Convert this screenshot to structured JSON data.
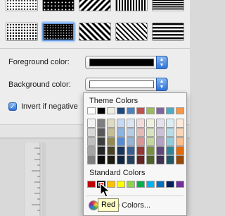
{
  "patterns": [
    {
      "name": "pattern-dots-small",
      "kind": "dots-small",
      "selected": false
    },
    {
      "name": "pattern-dots-medium",
      "kind": "dots-medium",
      "selected": false
    },
    {
      "name": "pattern-diagonal-wide",
      "kind": "diag-wide",
      "selected": false
    },
    {
      "name": "pattern-vertical-lines",
      "kind": "vertical",
      "selected": false
    },
    {
      "name": "pattern-horizontal-lines",
      "kind": "horizontal-fine",
      "selected": false
    },
    {
      "name": "pattern-dots-large",
      "kind": "dots-large",
      "selected": false
    },
    {
      "name": "pattern-dots-dense",
      "kind": "dots-dense",
      "selected": true
    },
    {
      "name": "pattern-diagonal-thick",
      "kind": "diag-thick",
      "selected": false
    },
    {
      "name": "pattern-diagonal-thin",
      "kind": "diag-thin",
      "selected": false
    },
    {
      "name": "pattern-horizontal-wide",
      "kind": "horizontal-wide",
      "selected": false
    }
  ],
  "fields": {
    "foreground_label": "Foreground color:",
    "foreground_value": "#000000",
    "background_label": "Background color:",
    "background_value": "#ffffff",
    "invert_label": "Invert if negative",
    "invert_checked": true
  },
  "popup": {
    "theme_title": "Theme Colors",
    "standard_title": "Standard Colors",
    "more_label": "More Colors...",
    "theme_colors": [
      "#ffffff",
      "#000000",
      "#eeece1",
      "#1f497d",
      "#4f81bd",
      "#c0504d",
      "#9bbb59",
      "#8064a2",
      "#4bacc6",
      "#f79646"
    ],
    "theme_shade_columns": [
      [
        "#f2f2f2",
        "#d8d8d8",
        "#bfbfbf",
        "#a5a5a5",
        "#7f7f7f"
      ],
      [
        "#7f7f7f",
        "#595959",
        "#3f3f3f",
        "#262626",
        "#0c0c0c"
      ],
      [
        "#ddd9c3",
        "#c4bd97",
        "#938953",
        "#494429",
        "#1d1b10"
      ],
      [
        "#c6d9f0",
        "#8db3e2",
        "#548dd4",
        "#17365d",
        "#0f243e"
      ],
      [
        "#dbe5f1",
        "#b8cce4",
        "#95b3d7",
        "#366092",
        "#244061"
      ],
      [
        "#f2dcdb",
        "#e5b9b7",
        "#d99694",
        "#953734",
        "#632423"
      ],
      [
        "#ebf1dd",
        "#d7e3bc",
        "#c3d69b",
        "#76923c",
        "#4f6128"
      ],
      [
        "#e5e0ec",
        "#ccc1d9",
        "#b2a2c7",
        "#5f497a",
        "#3f3151"
      ],
      [
        "#dbeef3",
        "#b7dde8",
        "#92cddc",
        "#31859b",
        "#205867"
      ],
      [
        "#fdeada",
        "#fbd5b5",
        "#fac08f",
        "#e36c09",
        "#974806"
      ]
    ],
    "standard_colors": [
      "#c00000",
      "#ff0000",
      "#ffc000",
      "#ffff00",
      "#92d050",
      "#00b050",
      "#00b0f0",
      "#0070c0",
      "#002060",
      "#7030a0"
    ],
    "hover_index": 1
  },
  "tooltip": "Red"
}
